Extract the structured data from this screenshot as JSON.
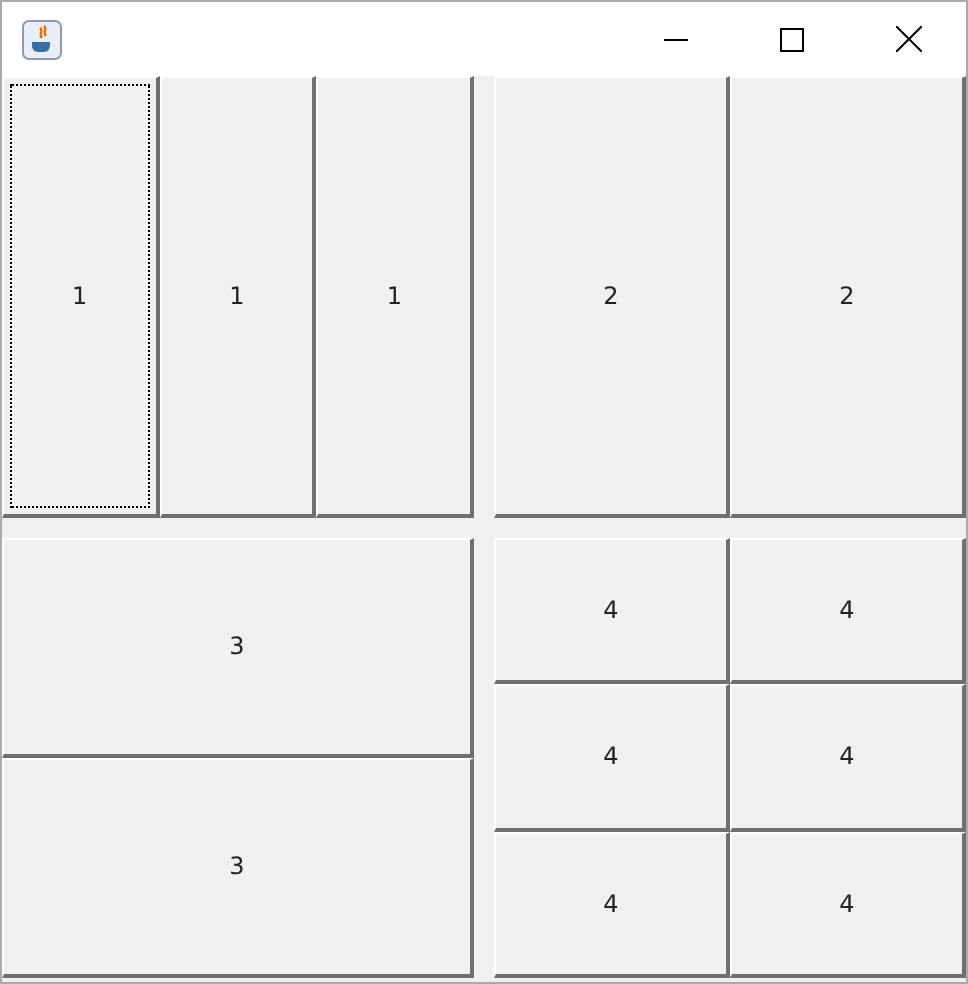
{
  "window": {
    "controls": [
      {
        "kind": "minimize"
      },
      {
        "kind": "maximize"
      },
      {
        "kind": "close"
      }
    ]
  },
  "top_left_panel": {
    "rows": [
      [
        {
          "label": "1",
          "focused": true
        },
        {
          "label": "1",
          "focused": false
        },
        {
          "label": "1",
          "focused": false
        }
      ]
    ]
  },
  "top_right_panel": {
    "rows": [
      [
        {
          "label": "2",
          "focused": false
        },
        {
          "label": "2",
          "focused": false
        }
      ]
    ]
  },
  "bottom_left_panel": {
    "rows": [
      [
        {
          "label": "3",
          "focused": false
        }
      ],
      [
        {
          "label": "3",
          "focused": false
        }
      ]
    ]
  },
  "bottom_right_panel": {
    "rows": [
      [
        {
          "label": "4",
          "focused": false
        },
        {
          "label": "4",
          "focused": false
        }
      ],
      [
        {
          "label": "4",
          "focused": false
        },
        {
          "label": "4",
          "focused": false
        }
      ],
      [
        {
          "label": "4",
          "focused": false
        },
        {
          "label": "4",
          "focused": false
        }
      ]
    ]
  }
}
